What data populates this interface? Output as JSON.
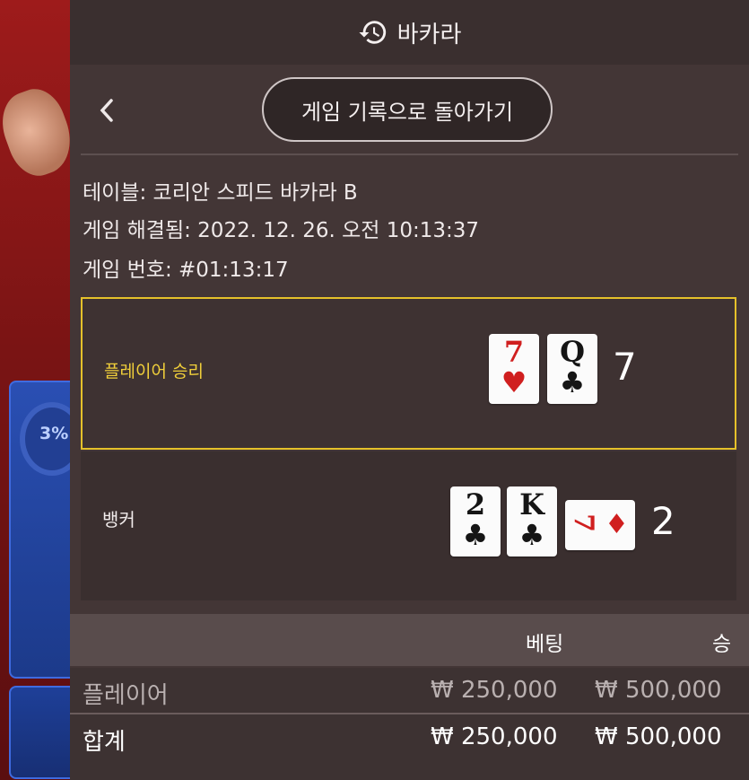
{
  "header": {
    "title": "바카라",
    "icon": "history-icon"
  },
  "nav": {
    "back_icon": "chevron-left-icon",
    "back_button_label": "게임 기록으로 돌아가기"
  },
  "info": {
    "table": "테이블: 코리안 스피드 바카라 B",
    "resolved": "게임 해결됨: 2022. 12. 26. 오전 10:13:37",
    "game_number": "게임 번호: #01:13:17"
  },
  "background": {
    "percent": "3%"
  },
  "player": {
    "label": "플레이어 승리",
    "cards": [
      {
        "rank": "7",
        "suit": "♥",
        "color": "#d01f1f"
      },
      {
        "rank": "Q",
        "suit": "♣",
        "color": "#151515"
      }
    ],
    "score": "7"
  },
  "banker": {
    "label": "뱅커",
    "cards": [
      {
        "rank": "2",
        "suit": "♣",
        "color": "#151515"
      },
      {
        "rank": "K",
        "suit": "♣",
        "color": "#151515"
      },
      {
        "rank": "7",
        "suit": "♦",
        "color": "#d01f1f"
      }
    ],
    "score": "2"
  },
  "bets_table": {
    "headers": {
      "bet": "베팅",
      "win": "승"
    },
    "rows": [
      {
        "label": "플레이어",
        "bet": "₩ 250,000",
        "win": "₩ 500,000"
      },
      {
        "label": "합계",
        "bet": "₩ 250,000",
        "win": "₩ 500,000"
      }
    ]
  },
  "colors": {
    "highlight": "#e5c12a",
    "panel": "#433636",
    "red_suit": "#d01f1f"
  }
}
